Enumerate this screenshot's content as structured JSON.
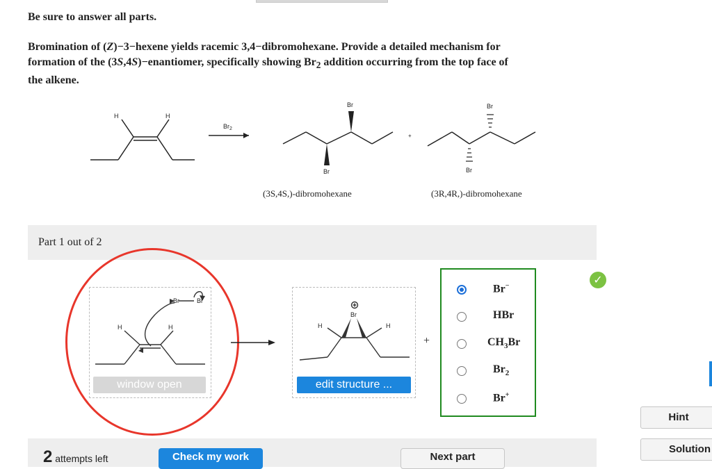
{
  "top": {
    "instruction": "Be sure to answer all parts."
  },
  "question": {
    "line1_pre": "Bromination of (",
    "line1_z": "Z",
    "line1_post": ")−3−hexene yields racemic 3,4−dibromohexane. Provide a detailed mechanism for",
    "line2_pre": "formation of the (3",
    "s1": "S",
    "comma4": ",4",
    "s2": "S",
    "line2_mid": ")−enantiomer, specifically showing Br",
    "sub2": "2",
    "line2_post": " addition occurring from the top face of",
    "line3": "the alkene."
  },
  "scheme": {
    "h_left": "H",
    "h_right": "H",
    "reagent": "Br",
    "reagent_sub": "2",
    "br": "Br",
    "plus": "+",
    "caption1": "(3S,4S,)-dibromohexane",
    "caption2": "(3R,4R,)-dibromohexane"
  },
  "part": {
    "title": "Part 1 out of 2"
  },
  "box1": {
    "br_a": "Br",
    "br_b": "Br",
    "h": "H",
    "button": "window open"
  },
  "box2": {
    "charge": "⊕",
    "br": "Br",
    "h": "H",
    "button": "edit structure ..."
  },
  "plus_sign": "+",
  "choices": [
    {
      "label": "Br",
      "sup": "−",
      "sub": "",
      "selected": true
    },
    {
      "label": "HBr",
      "sup": "",
      "sub": "",
      "selected": false
    },
    {
      "label": "CH",
      "sub": "3",
      "suffix": "Br",
      "sup": "",
      "selected": false
    },
    {
      "label": "Br",
      "sub": "2",
      "sup": "",
      "selected": false
    },
    {
      "label": "Br",
      "sup": "+",
      "sub": "",
      "selected": false
    }
  ],
  "status": {
    "check_icon": "✓",
    "check_color": "#7cc242",
    "choice_border_color": "#1f8a1f",
    "annotation_color": "#e8362b"
  },
  "side": {
    "hint": "Hint",
    "solution": "Solution"
  },
  "footer": {
    "attempts_num": "2",
    "attempts_text": "attempts left",
    "check": "Check my work",
    "next": "Next part"
  }
}
